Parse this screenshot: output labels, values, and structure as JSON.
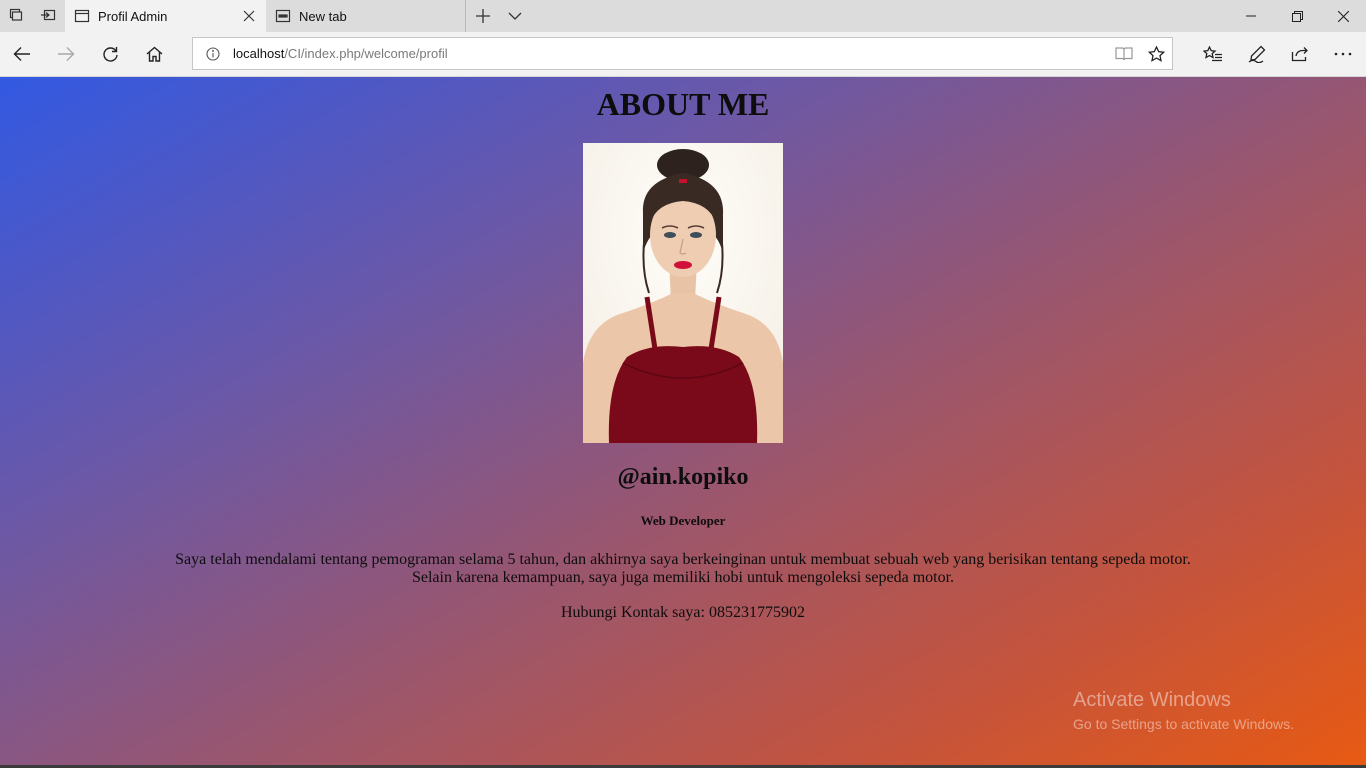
{
  "browser": {
    "tabs": [
      {
        "title": "Profil Admin",
        "active": true
      },
      {
        "title": "New tab",
        "active": false
      }
    ],
    "address": {
      "host": "localhost",
      "path": "/CI/index.php/welcome/profil"
    }
  },
  "page": {
    "title": "ABOUT ME",
    "handle": "@ain.kopiko",
    "role": "Web Developer",
    "bio_line1": "Saya telah mendalami tentang pemograman selama 5 tahun, dan akhirnya saya berkeinginan untuk membuat sebuah web yang berisikan tentang sepeda motor.",
    "bio_line2": "Selain karena kemampuan, saya juga memiliki hobi untuk mengoleksi sepeda motor.",
    "contact": "Hubungi Kontak saya: 085231775902",
    "gradient_colors": [
      "#3259e2",
      "#6a58a8",
      "#99566f",
      "#c5543c",
      "#e85a12"
    ]
  },
  "watermark": {
    "line1": "Activate Windows",
    "line2": "Go to Settings to activate Windows."
  },
  "icons": [
    "tab-manager-icon",
    "set-aside-tabs-icon",
    "page-icon",
    "close-icon",
    "new-tab-page-icon",
    "plus-icon",
    "chevron-down-icon",
    "minimize-icon",
    "restore-icon",
    "back-arrow-icon",
    "forward-arrow-icon",
    "refresh-icon",
    "home-icon",
    "info-icon",
    "reading-view-icon",
    "star-icon",
    "favorites-icon",
    "pen-icon",
    "share-icon",
    "more-icon"
  ]
}
